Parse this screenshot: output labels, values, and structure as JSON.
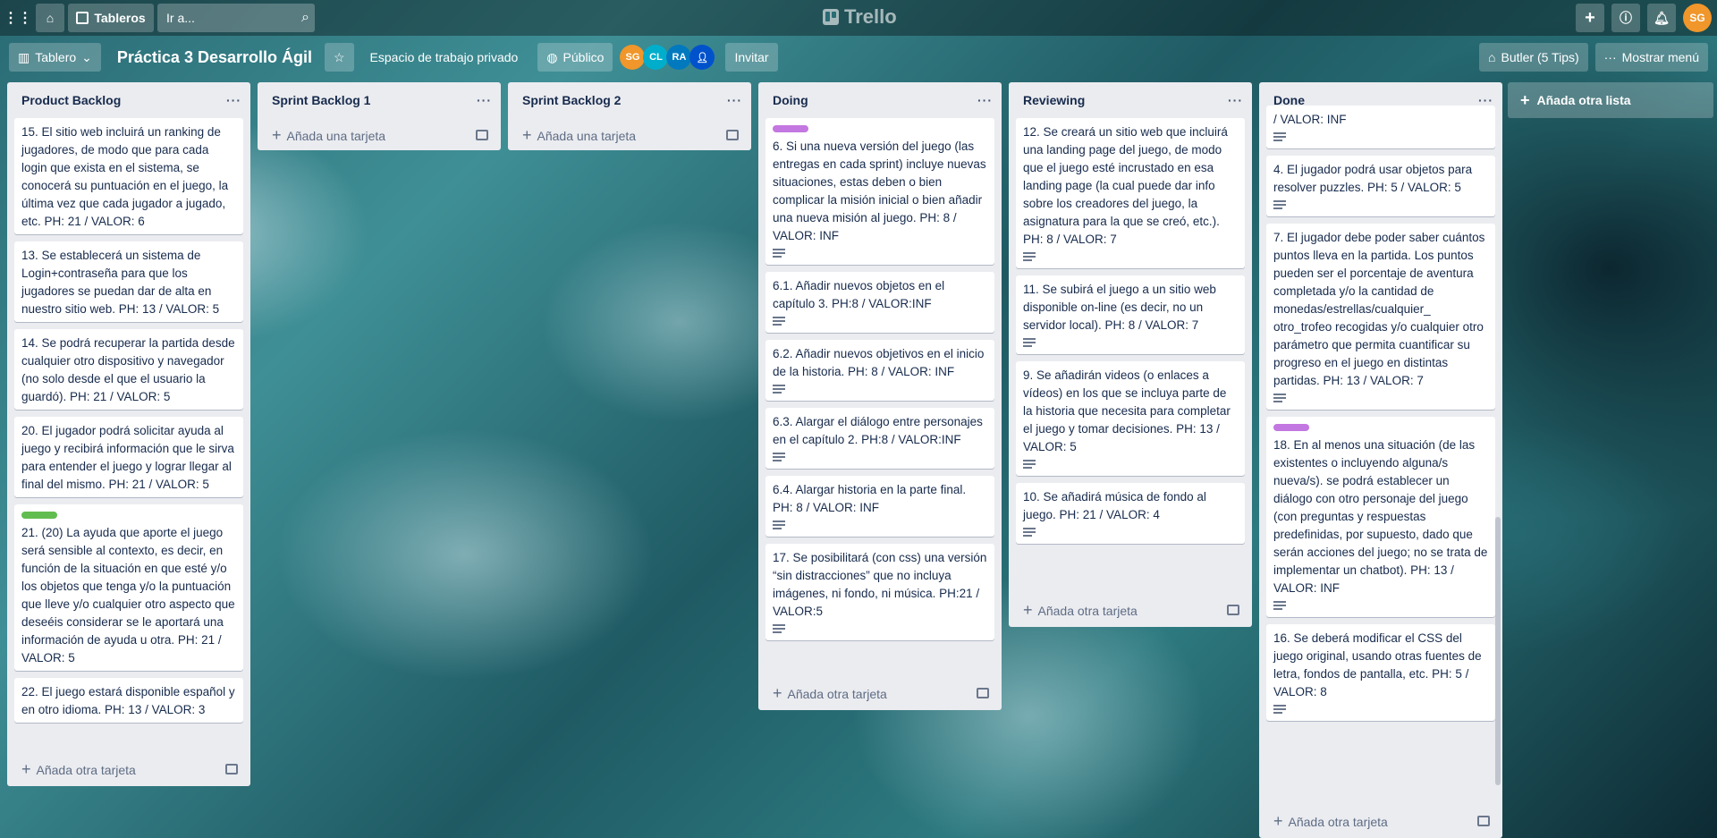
{
  "topbar": {
    "boards_label": "Tableros",
    "search_placeholder": "Ir a...",
    "logo_text": "Trello",
    "user_initials": "SG"
  },
  "board": {
    "view_label": "Tablero",
    "title": "Práctica 3 Desarrollo Ágil",
    "workspace_label": "Espacio de trabajo privado",
    "visibility_label": "Público",
    "members": [
      "SG",
      "CL",
      "RA",
      ""
    ],
    "invite_label": "Invitar",
    "butler_label": "Butler (5 Tips)",
    "menu_label": "Mostrar menú"
  },
  "add_list_label": "Añada otra lista",
  "colors": {
    "green_label": "#61bd4f",
    "purple_label": "#c377e0",
    "avatar_orange": "#f0962a",
    "avatar_blue": "#0079bf",
    "avatar_cyan": "#00aecc"
  },
  "lists": [
    {
      "title": "Product Backlog",
      "add_label": "Añada otra tarjeta",
      "cards": [
        {
          "text": "15. El sitio web incluirá un ranking de jugadores, de modo que para cada login que exista en el sistema, se conocerá su puntuación en el juego, la última vez que cada jugador a jugado, etc. PH: 21 / VALOR: 6"
        },
        {
          "text": "13. Se establecerá un sistema de Login+contraseña para que los jugadores se puedan dar de alta en nuestro sitio web. PH: 13 / VALOR: 5"
        },
        {
          "text": "14. Se podrá recuperar la partida desde cualquier otro dispositivo y navegador (no solo desde el que el usuario la guardó). PH: 21 / VALOR: 5"
        },
        {
          "text": "20. El jugador podrá solicitar ayuda al juego y recibirá información que le sirva para entender el juego y lograr llegar al final del mismo. PH: 21 / VALOR: 5"
        },
        {
          "text": "21. (20) La ayuda que aporte el juego será sensible al contexto, es decir, en función de la situación en que esté y/o los objetos que tenga y/o la puntuación que lleve y/o cualquier otro aspecto que deseéis considerar se le aportará una información de ayuda u otra. PH: 21 / VALOR: 5"
        },
        {
          "text": "22. El juego estará disponible español y en otro idioma. PH: 13 / VALOR: 3"
        }
      ]
    },
    {
      "title": "Sprint Backlog 1",
      "add_label": "Añada una tarjeta",
      "cards": []
    },
    {
      "title": "Sprint Backlog 2",
      "add_label": "Añada una tarjeta",
      "cards": []
    },
    {
      "title": "Doing",
      "add_label": "Añada otra tarjeta",
      "cards": [
        {
          "text": "6. Si una nueva versión del juego (las entregas en cada sprint) incluye nuevas situaciones, estas deben o bien complicar la misión inicial o bien añadir una nueva misión al juego. PH: 8 / VALOR: INF"
        },
        {
          "text": "6.1. Añadir nuevos objetos en el capítulo 3. PH:8 / VALOR:INF"
        },
        {
          "text": "6.2. Añadir nuevos objetivos en el inicio de la historia. PH: 8 / VALOR: INF"
        },
        {
          "text": "6.3. Alargar el diálogo entre personajes en el capítulo 2. PH:8 / VALOR:INF"
        },
        {
          "text": "6.4. Alargar historia en la parte final. PH: 8 / VALOR: INF"
        },
        {
          "text": "17. Se posibilitará (con css) una versión “sin distracciones” que no incluya imágenes, ni fondo, ni música. PH:21 / VALOR:5"
        }
      ]
    },
    {
      "title": "Reviewing",
      "add_label": "Añada otra tarjeta",
      "cards": [
        {
          "text": "12. Se creará un sitio web que incluirá una landing page del juego, de modo que el juego esté incrustado en esa landing page (la cual puede dar info sobre los creadores del juego, la asignatura para la que se creó, etc.). PH: 8 / VALOR: 7"
        },
        {
          "text": "11. Se subirá el juego a un sitio web disponible on-line (es decir, no un servidor local). PH: 8 / VALOR: 7"
        },
        {
          "text": "9. Se añadirán videos (o enlaces a vídeos) en los que se incluya parte de la historia que necesita para completar el juego y tomar decisiones. PH: 13 / VALOR: 5"
        },
        {
          "text": "10. Se añadirá música de fondo al juego. PH: 21 / VALOR: 4"
        }
      ]
    },
    {
      "title": "Done",
      "add_label": "Añada otra tarjeta",
      "cards": [
        {
          "text": "/ VALOR: INF"
        },
        {
          "text": "4. El jugador podrá usar objetos para resolver puzzles. PH: 5 / VALOR: 5"
        },
        {
          "text": "7. El jugador debe poder saber cuántos puntos lleva en la partida. Los puntos pueden ser el porcentaje de aventura completada y/o la cantidad de monedas/estrellas/cualquier_ otro_trofeo recogidas y/o cualquier otro parámetro que permita cuantificar su progreso en el juego en distintas partidas. PH: 13 / VALOR: 7"
        },
        {
          "text": "18. En al menos una situación (de las existentes o incluyendo alguna/s nueva/s). se podrá establecer un diálogo con otro personaje del juego (con preguntas y respuestas predefinidas, por supuesto, dado que serán acciones del juego; no se trata de implementar un chatbot). PH: 13 / VALOR: INF"
        },
        {
          "text": "16. Se deberá modificar el CSS del juego original, usando otras fuentes de letra, fondos de pantalla, etc. PH: 5 / VALOR: 8"
        }
      ]
    }
  ]
}
